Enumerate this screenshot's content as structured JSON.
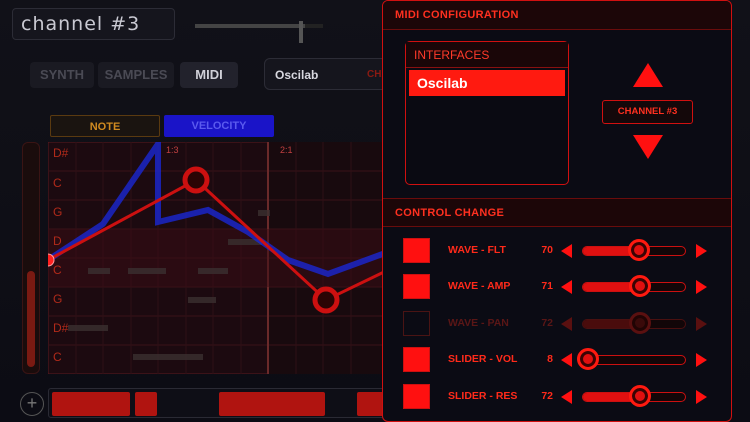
{
  "app": {
    "channel_title": "channel #3",
    "tabs": [
      "SYNTH",
      "SAMPLES",
      "MIDI"
    ],
    "instrument": "Oscilab",
    "instrument_suffix": "CHA",
    "mode_tabs": [
      "NOTE",
      "VELOCITY"
    ],
    "grid_markers": [
      "1:3",
      "2:1"
    ],
    "note_labels": [
      "D#",
      "C",
      "G",
      "D",
      "C",
      "G",
      "D#",
      "C"
    ]
  },
  "midi_config": {
    "title": "MIDI CONFIGURATION",
    "interfaces_title": "INTERFACES",
    "interfaces": [
      "Oscilab"
    ],
    "selected_interface": "Oscilab",
    "channel_label": "CHANNEL #3",
    "control_change_title": "CONTROL CHANGE",
    "controls": [
      {
        "label": "WAVE - FLT",
        "value": "70",
        "enabled": true,
        "level": 0.55
      },
      {
        "label": "WAVE - AMP",
        "value": "71",
        "enabled": true,
        "level": 0.56
      },
      {
        "label": "WAVE - PAN",
        "value": "72",
        "enabled": false,
        "level": 0.56
      },
      {
        "label": "SLIDER - VOL",
        "value": "8",
        "enabled": true,
        "level": 0.06
      },
      {
        "label": "SLIDER - RES",
        "value": "72",
        "enabled": true,
        "level": 0.56
      }
    ]
  },
  "colors": {
    "accent": "#ff1010",
    "panel_bg": "#0b0b14",
    "velocity_tab": "#1a14c8",
    "note_tab_text": "#d08a20"
  }
}
